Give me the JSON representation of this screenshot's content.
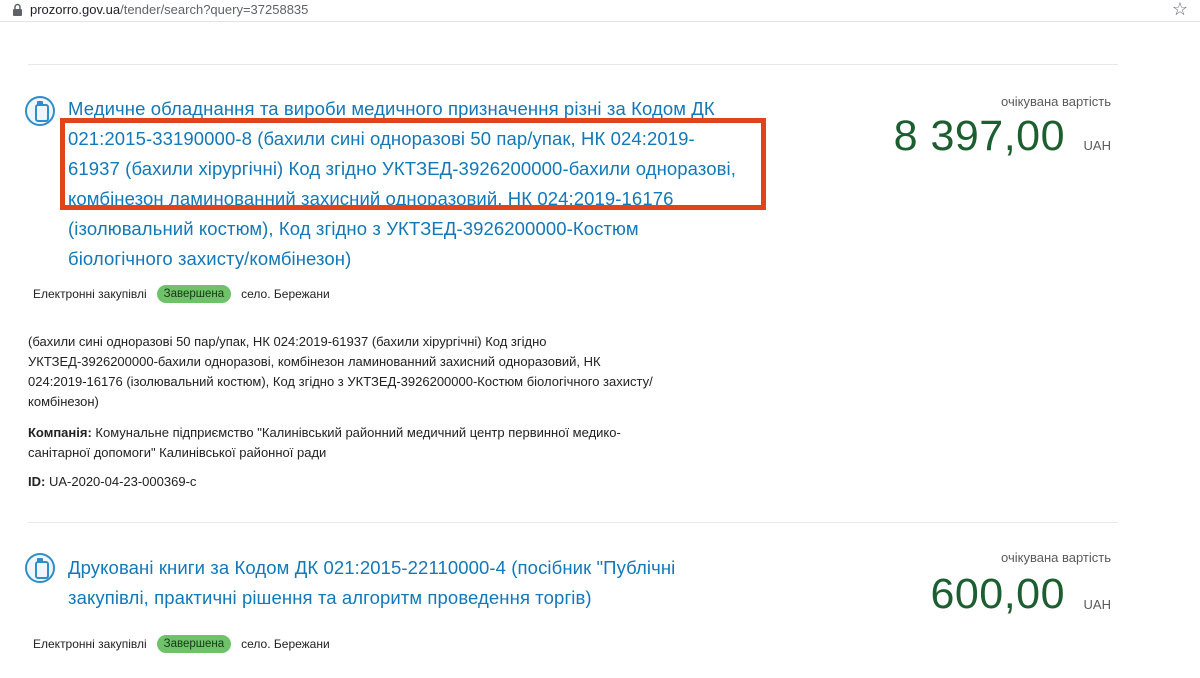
{
  "browser": {
    "url_host": "prozorro.gov.ua",
    "url_path": "/tender/search?query=37258835"
  },
  "tenders": [
    {
      "title_lines": [
        "Медичне обладнання та вироби медичного призначення різні за Кодом ДК",
        "021:2015-33190000-8 (бахили сині одноразові 50 пар/упак, НК 024:2019-",
        "61937 (бахили хірургічні) Код згідно УКТЗЕД-3926200000-бахили одноразові,",
        "комбінезон ламинованний захисний одноразовий, НК 024:2019-16176",
        "(ізолювальний костюм), Код згідно з УКТЗЕД-3926200000-Костюм",
        "біологічного захисту/комбінезон)"
      ],
      "price_label": "очікувана вартість",
      "price": "8 397,00",
      "currency": "UAH",
      "procurement_type": "Електронні закупівлі",
      "status": "Завершена",
      "location": "село. Бережани",
      "description_lines": [
        "(бахили сині одноразові 50 пар/упак, НК 024:2019-61937 (бахили хірургічні) Код згідно",
        "УКТЗЕД-3926200000-бахили одноразові, комбінезон ламинованний захисний одноразовий, НК",
        "024:2019-16176 (ізолювальний костюм), Код згідно з УКТЗЕД-3926200000-Костюм біологічного захисту/",
        "комбінезон)"
      ],
      "company_label": "Компанія:",
      "company_lines": [
        "Комунальне підприємство \"Калинівський районний медичний центр первинної медико-",
        "санітарної допомоги\" Калинівської районної ради"
      ],
      "id_label": "ID:",
      "id_value": "UA-2020-04-23-000369-c"
    },
    {
      "title_lines": [
        "Друковані книги за Кодом ДК 021:2015-22110000-4 (посібник \"Публічні",
        "закупівлі, практичні рішення та алгоритм проведення торгів)"
      ],
      "price_label": "очікувана вартість",
      "price": "600,00",
      "currency": "UAH",
      "procurement_type": "Електронні закупівлі",
      "status": "Завершена",
      "location": "село. Бережани"
    }
  ],
  "colors": {
    "link": "#1278b8",
    "price": "#1c5e2f",
    "status_badge": "#6fc26a",
    "highlight_box": "#e0441b"
  }
}
